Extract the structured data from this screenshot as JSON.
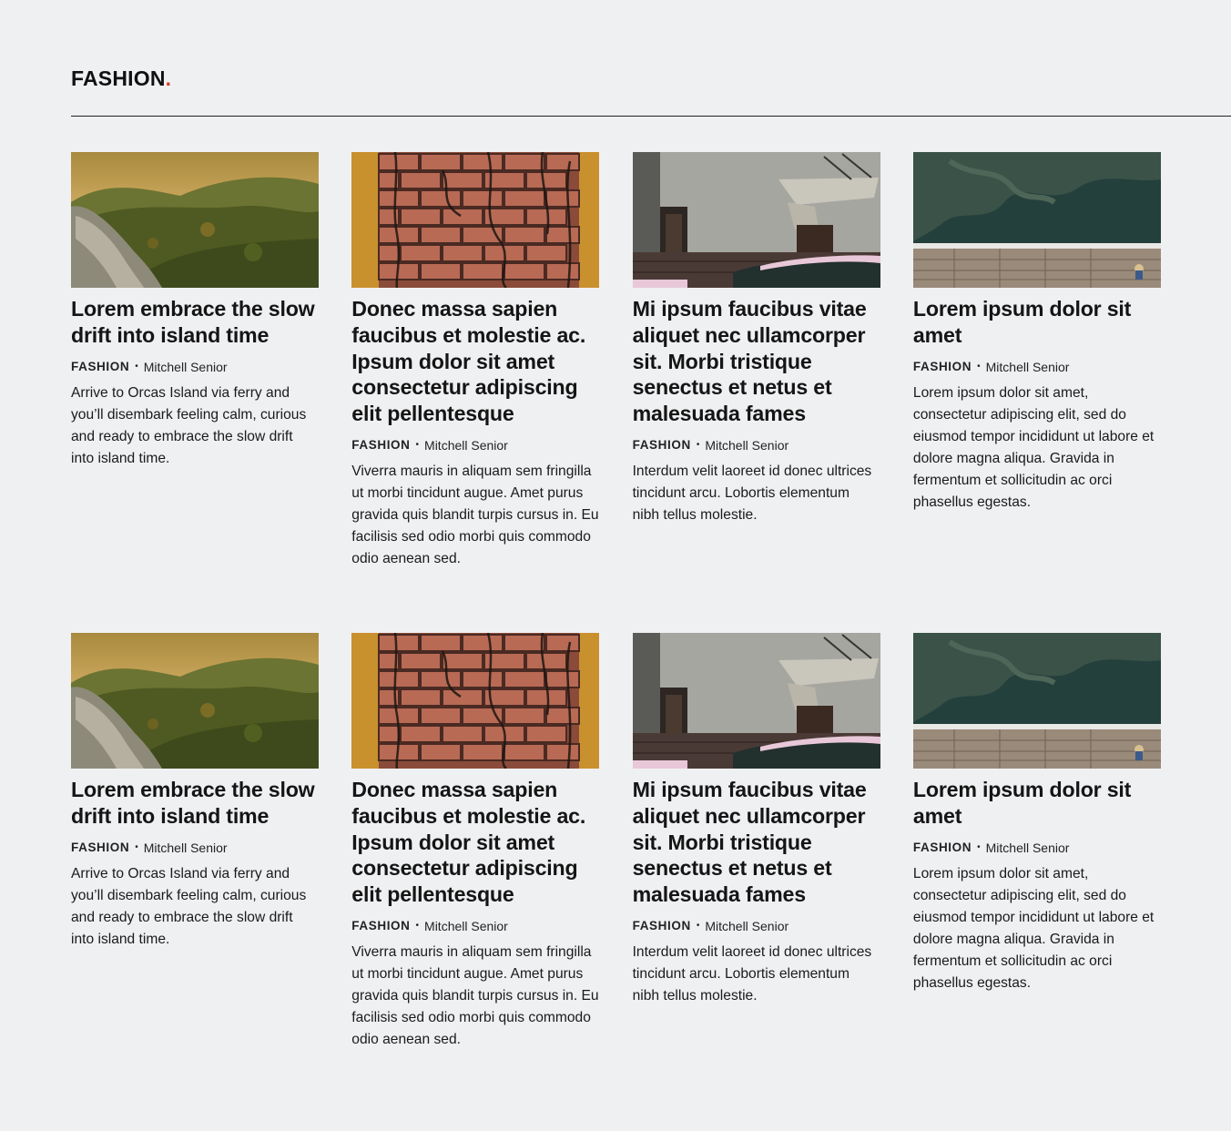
{
  "section": {
    "title": "FASHION",
    "dot": ".",
    "accent_color": "#e0392b"
  },
  "rows": [
    {
      "cards": [
        {
          "image": "mountain-forest-image",
          "title": "Lorem embrace the slow drift into island time",
          "category": "FASHION",
          "author": "Mitchell Senior",
          "excerpt": "Arrive to Orcas Island via ferry and you’ll disembark feeling calm, curious and ready to embrace the slow drift into island time."
        },
        {
          "image": "brick-wall-image",
          "title": "Donec massa sapien faucibus et molestie ac. Ipsum dolor sit amet consectetur adipiscing elit pellentesque",
          "category": "FASHION",
          "author": "Mitchell Senior",
          "excerpt": "Viverra mauris in aliquam sem fringilla ut morbi tincidunt augue. Amet purus gravida quis blandit turpis cursus in. Eu facilisis sed odio morbi quis commodo odio aenean sed."
        },
        {
          "image": "old-building-image",
          "title": "Mi ipsum faucibus vitae aliquet nec ullamcorper sit. Morbi tristique senectus et netus et malesuada fames",
          "category": "FASHION",
          "author": "Mitchell Senior",
          "excerpt": "Interdum velit laoreet id donec ultrices tincidunt arcu. Lobortis elementum nibh tellus molestie."
        },
        {
          "image": "aerial-pier-image",
          "title": "Lorem ipsum dolor sit amet",
          "category": "FASHION",
          "author": "Mitchell Senior",
          "excerpt": "Lorem ipsum dolor sit amet, consectetur adipiscing elit, sed do eiusmod tempor incididunt ut labore et dolore magna aliqua. Gravida in fermentum et sollicitudin ac orci phasellus egestas."
        }
      ]
    },
    {
      "cards": [
        {
          "image": "mountain-forest-image",
          "title": "Lorem embrace the slow drift into island time",
          "category": "FASHION",
          "author": "Mitchell Senior",
          "excerpt": "Arrive to Orcas Island via ferry and you’ll disembark feeling calm, curious and ready to embrace the slow drift into island time."
        },
        {
          "image": "brick-wall-image",
          "title": "Donec massa sapien faucibus et molestie ac. Ipsum dolor sit amet consectetur adipiscing elit pellentesque",
          "category": "FASHION",
          "author": "Mitchell Senior",
          "excerpt": "Viverra mauris in aliquam sem fringilla ut morbi tincidunt augue. Amet purus gravida quis blandit turpis cursus in. Eu facilisis sed odio morbi quis commodo odio aenean sed."
        },
        {
          "image": "old-building-image",
          "title": "Mi ipsum faucibus vitae aliquet nec ullamcorper sit. Morbi tristique senectus et netus et malesuada fames",
          "category": "FASHION",
          "author": "Mitchell Senior",
          "excerpt": "Interdum velit laoreet id donec ultrices tincidunt arcu. Lobortis elementum nibh tellus molestie."
        },
        {
          "image": "aerial-pier-image",
          "title": "Lorem ipsum dolor sit amet",
          "category": "FASHION",
          "author": "Mitchell Senior",
          "excerpt": "Lorem ipsum dolor sit amet, consectetur adipiscing elit, sed do eiusmod tempor incididunt ut labore et dolore magna aliqua. Gravida in fermentum et sollicitudin ac orci phasellus egestas."
        }
      ]
    }
  ]
}
